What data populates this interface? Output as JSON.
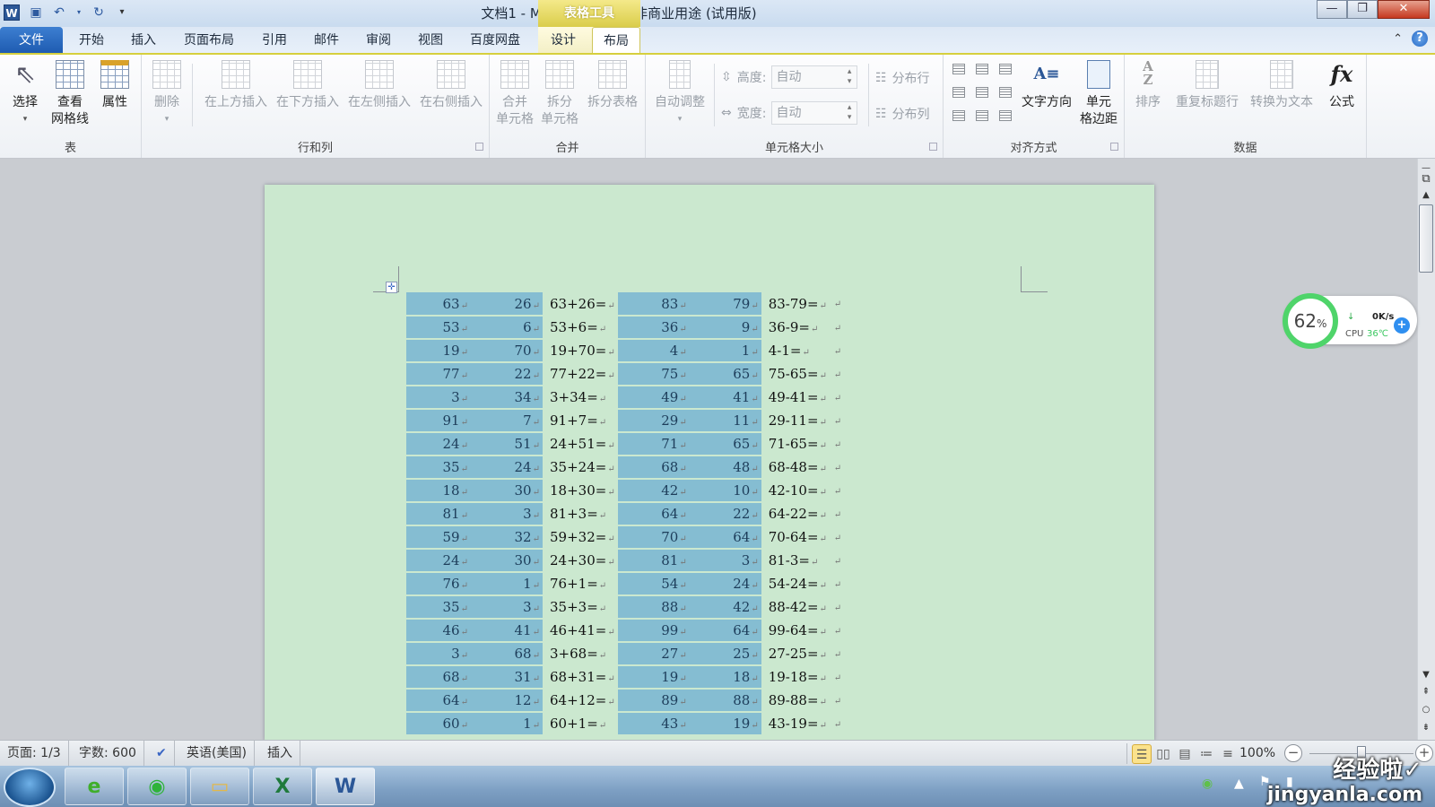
{
  "window": {
    "title": "文档1 - Microsoft Word 非商业用途 (试用版)",
    "context_tools_label": "表格工具",
    "app_icon": "word-icon",
    "quick_access": [
      "save-icon",
      "undo-icon",
      "redo-icon",
      "customize-qat-icon"
    ],
    "controls": {
      "minimize": "—",
      "restore": "❐",
      "close": "✕"
    }
  },
  "tabs": [
    {
      "label": "文件",
      "active": false
    },
    {
      "label": "开始",
      "active": false
    },
    {
      "label": "插入",
      "active": false
    },
    {
      "label": "页面布局",
      "active": false
    },
    {
      "label": "引用",
      "active": false
    },
    {
      "label": "邮件",
      "active": false
    },
    {
      "label": "审阅",
      "active": false
    },
    {
      "label": "视图",
      "active": false
    },
    {
      "label": "百度网盘",
      "active": false
    },
    {
      "label": "设计",
      "active": false
    },
    {
      "label": "布局",
      "active": true
    }
  ],
  "ribbon": {
    "groups": {
      "table": {
        "label": "表",
        "buttons": {
          "select": "选择",
          "gridlines_1": "查看",
          "gridlines_2": "网格线",
          "properties": "属性"
        }
      },
      "rows_cols": {
        "label": "行和列",
        "buttons": {
          "delete": "删除",
          "insert_above": "在上方插入",
          "insert_below": "在下方插入",
          "insert_left": "在左侧插入",
          "insert_right": "在右侧插入"
        }
      },
      "merge": {
        "label": "合并",
        "buttons": {
          "merge_1": "合并",
          "merge_2": "单元格",
          "split_1": "拆分",
          "split_2": "单元格",
          "split_table": "拆分表格"
        }
      },
      "cell_size": {
        "label": "单元格大小",
        "autofit": "自动调整",
        "height_label": "高度:",
        "height_value": "自动",
        "width_label": "宽度:",
        "width_value": "自动",
        "distribute_rows": "分布行",
        "distribute_cols": "分布列"
      },
      "alignment": {
        "label": "对齐方式",
        "text_direction": "文字方向",
        "margins_1": "单元",
        "margins_2": "格边距"
      },
      "data": {
        "label": "数据",
        "sort": "排序",
        "repeat_header": "重复标题行",
        "convert_text": "转换为文本",
        "formula": "公式"
      }
    }
  },
  "document": {
    "table_rows": [
      {
        "a": "63",
        "b": "26",
        "add": "63+26=",
        "c": "83",
        "d": "79",
        "sub": "83-79="
      },
      {
        "a": "53",
        "b": "6",
        "add": "53+6=",
        "c": "36",
        "d": "9",
        "sub": "36-9="
      },
      {
        "a": "19",
        "b": "70",
        "add": "19+70=",
        "c": "4",
        "d": "1",
        "sub": "4-1="
      },
      {
        "a": "77",
        "b": "22",
        "add": "77+22=",
        "c": "75",
        "d": "65",
        "sub": "75-65="
      },
      {
        "a": "3",
        "b": "34",
        "add": "3+34=",
        "c": "49",
        "d": "41",
        "sub": "49-41="
      },
      {
        "a": "91",
        "b": "7",
        "add": "91+7=",
        "c": "29",
        "d": "11",
        "sub": "29-11="
      },
      {
        "a": "24",
        "b": "51",
        "add": "24+51=",
        "c": "71",
        "d": "65",
        "sub": "71-65="
      },
      {
        "a": "35",
        "b": "24",
        "add": "35+24=",
        "c": "68",
        "d": "48",
        "sub": "68-48="
      },
      {
        "a": "18",
        "b": "30",
        "add": "18+30=",
        "c": "42",
        "d": "10",
        "sub": "42-10="
      },
      {
        "a": "81",
        "b": "3",
        "add": "81+3=",
        "c": "64",
        "d": "22",
        "sub": "64-22="
      },
      {
        "a": "59",
        "b": "32",
        "add": "59+32=",
        "c": "70",
        "d": "64",
        "sub": "70-64="
      },
      {
        "a": "24",
        "b": "30",
        "add": "24+30=",
        "c": "81",
        "d": "3",
        "sub": "81-3="
      },
      {
        "a": "76",
        "b": "1",
        "add": "76+1=",
        "c": "54",
        "d": "24",
        "sub": "54-24="
      },
      {
        "a": "35",
        "b": "3",
        "add": "35+3=",
        "c": "88",
        "d": "42",
        "sub": "88-42="
      },
      {
        "a": "46",
        "b": "41",
        "add": "46+41=",
        "c": "99",
        "d": "64",
        "sub": "99-64="
      },
      {
        "a": "3",
        "b": "68",
        "add": "3+68=",
        "c": "27",
        "d": "25",
        "sub": "27-25="
      },
      {
        "a": "68",
        "b": "31",
        "add": "68+31=",
        "c": "19",
        "d": "18",
        "sub": "19-18="
      },
      {
        "a": "64",
        "b": "12",
        "add": "64+12=",
        "c": "89",
        "d": "88",
        "sub": "89-88="
      },
      {
        "a": "60",
        "b": "1",
        "add": "60+1=",
        "c": "43",
        "d": "19",
        "sub": "43-19="
      }
    ],
    "paragraph_mark": "↵"
  },
  "widget": {
    "memory_percent": "62",
    "percent_sign": "%",
    "net_speed": "0K/s",
    "cpu_label": "CPU",
    "cpu_temp": "36℃"
  },
  "status_bar": {
    "page": "页面: 1/3",
    "words": "字数: 600",
    "language": "英语(美国)",
    "mode": "插入",
    "zoom": "100%",
    "zoom_fraction": 0.5
  },
  "taskbar": {
    "apps": [
      "ie-icon",
      "wifi-app-icon",
      "explorer-icon",
      "excel-icon",
      "word-icon"
    ],
    "watermark_1": "经验啦✓",
    "watermark_2": "jingyanla.com"
  },
  "colors": {
    "page_bg": "#cbe8cf",
    "cell_shade": "#85bdd2",
    "accent": "#2b5797",
    "context_tab": "#dacd4a"
  }
}
